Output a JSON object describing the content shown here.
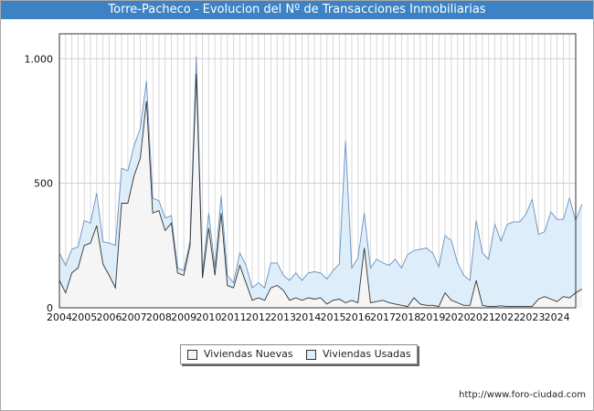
{
  "header": {
    "title": "Torre-Pacheco - Evolucion del Nº de Transacciones Inmobiliarias"
  },
  "footer": {
    "source": "http://www.foro-ciudad.com"
  },
  "chart_data": {
    "type": "area",
    "title": "Torre-Pacheco - Evolucion del Nº de Transacciones Inmobiliarias",
    "xlabel": "",
    "ylabel": "",
    "ylim": [
      0,
      1100
    ],
    "yticks": [
      0,
      500,
      1000
    ],
    "ytick_labels": [
      "0",
      "500",
      "1.000"
    ],
    "x_year_labels": [
      "2004",
      "2005",
      "2006",
      "2007",
      "2008",
      "2009",
      "2010",
      "2011",
      "2012",
      "2013",
      "2014",
      "2015",
      "2016",
      "2017",
      "2018",
      "2019",
      "2020",
      "2021",
      "2022",
      "2023",
      "2024"
    ],
    "x_start": 2004.0,
    "x_step": 0.25,
    "grid": true,
    "legend_position": "bottom-center",
    "stacked": true,
    "series": [
      {
        "name": "Viviendas Nuevas",
        "color": "#f5f5f5",
        "line_color": "#333333",
        "values": [
          110,
          60,
          140,
          160,
          250,
          260,
          330,
          175,
          130,
          80,
          420,
          420,
          530,
          600,
          830,
          380,
          390,
          310,
          340,
          140,
          130,
          250,
          940,
          120,
          320,
          130,
          380,
          90,
          80,
          170,
          100,
          30,
          40,
          30,
          80,
          90,
          70,
          30,
          40,
          30,
          40,
          35,
          40,
          15,
          30,
          35,
          20,
          30,
          20,
          240,
          20,
          25,
          30,
          20,
          15,
          10,
          5,
          40,
          15,
          10,
          10,
          5,
          60,
          30,
          20,
          10,
          10,
          110,
          10,
          5,
          5,
          8,
          5,
          5,
          5,
          5,
          5,
          35,
          45,
          35,
          25,
          45,
          40,
          60,
          75
        ]
      },
      {
        "name": "Viviendas Usadas",
        "color": "#ddeefa",
        "line_color": "#6a8fc0",
        "values": [
          110,
          110,
          95,
          85,
          100,
          80,
          130,
          90,
          130,
          170,
          140,
          130,
          120,
          120,
          80,
          60,
          40,
          50,
          30,
          20,
          20,
          20,
          70,
          20,
          60,
          30,
          70,
          40,
          20,
          50,
          70,
          50,
          60,
          50,
          100,
          90,
          60,
          80,
          100,
          80,
          100,
          110,
          100,
          100,
          120,
          140,
          650,
          130,
          180,
          140,
          140,
          170,
          150,
          150,
          180,
          150,
          210,
          190,
          220,
          230,
          210,
          160,
          230,
          240,
          160,
          120,
          100,
          240,
          210,
          190,
          330,
          260,
          330,
          340,
          340,
          370,
          430,
          260,
          260,
          350,
          330,
          310,
          400,
          290,
          340,
          270
        ]
      }
    ]
  }
}
